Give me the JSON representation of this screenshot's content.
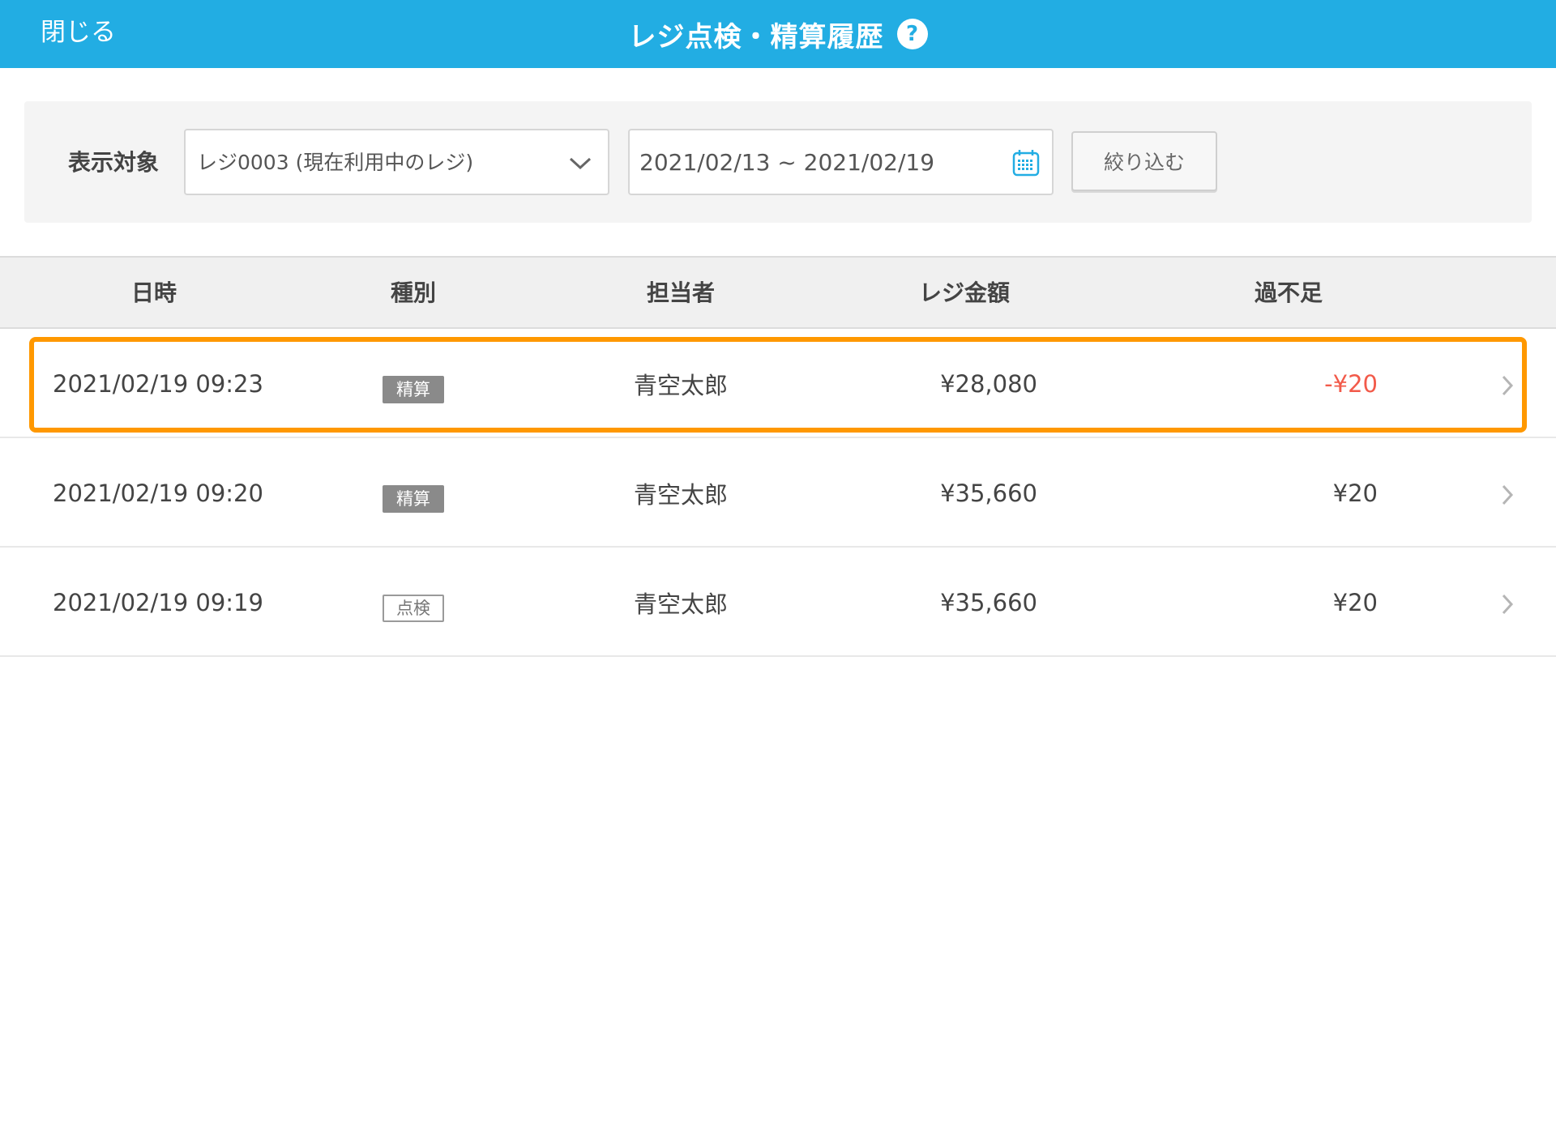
{
  "header": {
    "close_label": "閉じる",
    "title": "レジ点検・精算履歴",
    "help_label": "?"
  },
  "filter": {
    "label": "表示対象",
    "register_value": "レジ0003 (現在利用中のレジ)",
    "date_range_value": "2021/02/13 ~ 2021/02/19",
    "button_label": "絞り込む"
  },
  "table": {
    "columns": [
      "日時",
      "種別",
      "担当者",
      "レジ金額",
      "過不足"
    ],
    "rows": [
      {
        "datetime": "2021/02/19 09:23",
        "type": "精算",
        "staff": "青空太郎",
        "amount": "¥28,080",
        "diff": "-¥20"
      },
      {
        "datetime": "2021/02/19 09:20",
        "type": "精算",
        "staff": "青空太郎",
        "amount": "¥35,660",
        "diff": "¥20"
      },
      {
        "datetime": "2021/02/19 09:19",
        "type": "点検",
        "staff": "青空太郎",
        "amount": "¥35,660",
        "diff": "¥20"
      }
    ]
  },
  "colors": {
    "header_bg": "#22ade3",
    "highlight": "#ff9800",
    "negative": "#f25a4a"
  },
  "icons": {
    "dropdown": "chevron-down-icon",
    "calendar": "calendar-icon",
    "row_arrow": "chevron-right-icon",
    "help": "help-icon"
  }
}
